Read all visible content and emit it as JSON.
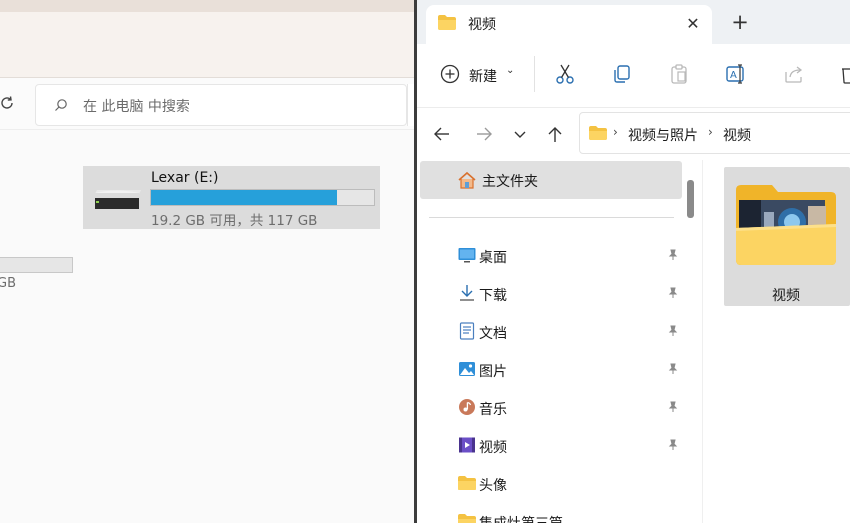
{
  "left_window": {
    "search": {
      "placeholder": "在 此电脑 中搜索"
    },
    "drive": {
      "name": "Lexar (E:)",
      "info": "19.2 GB 可用，共 117 GB",
      "used_fraction": 0.836
    },
    "partial_drive_info": "GB"
  },
  "right_window": {
    "tab": {
      "title": "视频"
    },
    "commands": {
      "new_label": "新建",
      "icons": [
        "cut-icon",
        "copy-icon",
        "paste-icon",
        "rename-icon",
        "share-icon",
        "delete-icon"
      ]
    },
    "breadcrumb": [
      "视频与照片",
      "视频"
    ],
    "nav": {
      "home_label": "主文件夹",
      "items": [
        {
          "label": "桌面",
          "icon": "desktop-icon",
          "pinned": true
        },
        {
          "label": "下载",
          "icon": "download-icon",
          "pinned": true
        },
        {
          "label": "文档",
          "icon": "documents-icon",
          "pinned": true
        },
        {
          "label": "图片",
          "icon": "pictures-icon",
          "pinned": true
        },
        {
          "label": "音乐",
          "icon": "music-icon",
          "pinned": true
        },
        {
          "label": "视频",
          "icon": "videos-icon",
          "pinned": true
        },
        {
          "label": "头像",
          "icon": "folder-icon",
          "pinned": false
        },
        {
          "label": "集成灶第三篇",
          "icon": "folder-icon",
          "pinned": false
        }
      ]
    },
    "content": {
      "folders": [
        {
          "label": "视频"
        }
      ]
    }
  },
  "colors": {
    "drive_bar_fill": "#26a0da",
    "selection": "#e0e0e0",
    "folder_yellow": "#f4c242"
  }
}
